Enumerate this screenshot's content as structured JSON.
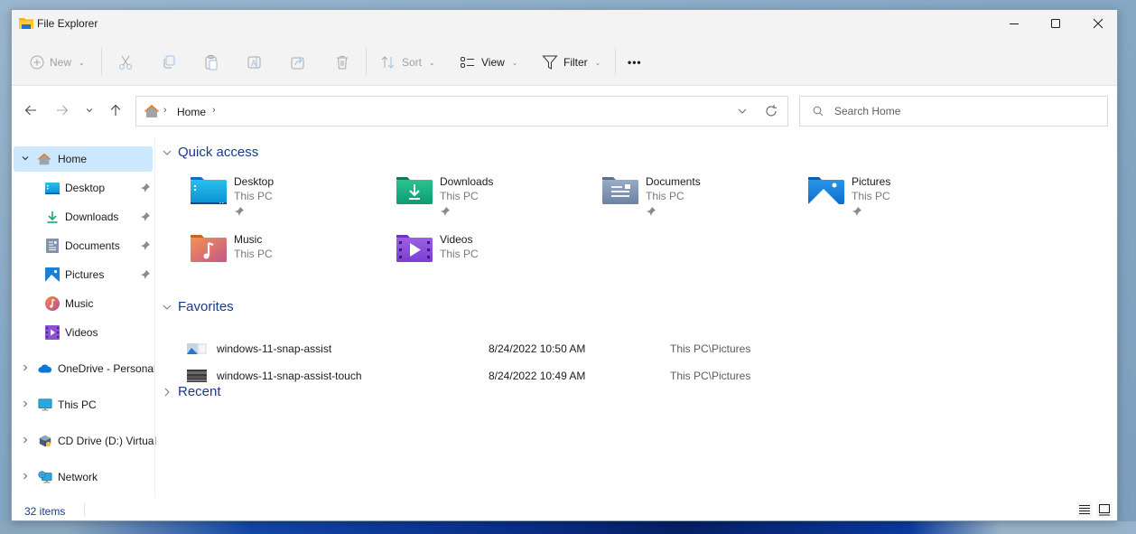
{
  "window": {
    "title": "File Explorer",
    "app_icon": "folder-icon",
    "controls": {
      "minimize": "minimize-icon",
      "maximize": "maximize-icon",
      "close": "close-icon"
    }
  },
  "toolbar": {
    "new_label": "New",
    "sort_label": "Sort",
    "view_label": "View",
    "filter_label": "Filter",
    "more_label": "•••",
    "icons": [
      "add-circle-icon",
      "cut-icon",
      "copy-icon",
      "paste-icon",
      "rename-icon",
      "share-icon",
      "delete-icon",
      "sort-icon",
      "view-icon",
      "filter-icon",
      "more-icon"
    ]
  },
  "navigation": {
    "breadcrumb": [
      {
        "label": "Home",
        "icon": "home-icon"
      }
    ],
    "search": {
      "placeholder": "Search Home",
      "value": ""
    }
  },
  "sidebar": {
    "items": [
      {
        "label": "Home",
        "icon": "home-icon",
        "expanded": true,
        "selected": true
      },
      {
        "label": "Desktop",
        "icon": "desktop-folder-icon",
        "pinned": true
      },
      {
        "label": "Downloads",
        "icon": "download-icon",
        "pinned": true
      },
      {
        "label": "Documents",
        "icon": "documents-icon",
        "pinned": true
      },
      {
        "label": "Pictures",
        "icon": "pictures-icon",
        "pinned": true
      },
      {
        "label": "Music",
        "icon": "music-icon",
        "pinned": false
      },
      {
        "label": "Videos",
        "icon": "videos-icon",
        "pinned": false
      },
      {
        "label": "OneDrive - Personal",
        "icon": "onedrive-icon",
        "expanded": false
      },
      {
        "label": "This PC",
        "icon": "pc-icon",
        "expanded": false
      },
      {
        "label": "CD Drive (D:) Virtual",
        "icon": "cd-drive-icon",
        "expanded": false
      },
      {
        "label": "Network",
        "icon": "network-icon",
        "expanded": false
      }
    ]
  },
  "content": {
    "quick_access": {
      "title": "Quick access",
      "items": [
        {
          "name": "Desktop",
          "location": "This PC",
          "pinned": true,
          "icon": "desktop-folder-icon"
        },
        {
          "name": "Downloads",
          "location": "This PC",
          "pinned": true,
          "icon": "downloads-folder-icon"
        },
        {
          "name": "Documents",
          "location": "This PC",
          "pinned": true,
          "icon": "documents-folder-icon"
        },
        {
          "name": "Pictures",
          "location": "This PC",
          "pinned": true,
          "icon": "pictures-folder-icon"
        },
        {
          "name": "Music",
          "location": "This PC",
          "pinned": false,
          "icon": "music-folder-icon"
        },
        {
          "name": "Videos",
          "location": "This PC",
          "pinned": false,
          "icon": "videos-folder-icon"
        }
      ]
    },
    "favorites": {
      "title": "Favorites",
      "items": [
        {
          "name": "windows-11-snap-assist",
          "date": "8/24/2022 10:50 AM",
          "location": "This PC\\Pictures"
        },
        {
          "name": "windows-11-snap-assist-touch",
          "date": "8/24/2022 10:49 AM",
          "location": "This PC\\Pictures"
        }
      ]
    },
    "recent": {
      "title": "Recent",
      "expanded": false
    }
  },
  "status": {
    "item_count": "32 items"
  },
  "colors": {
    "accent": "#1a3a8a",
    "selection": "#cce8ff",
    "chrome": "#f3f3f3"
  }
}
